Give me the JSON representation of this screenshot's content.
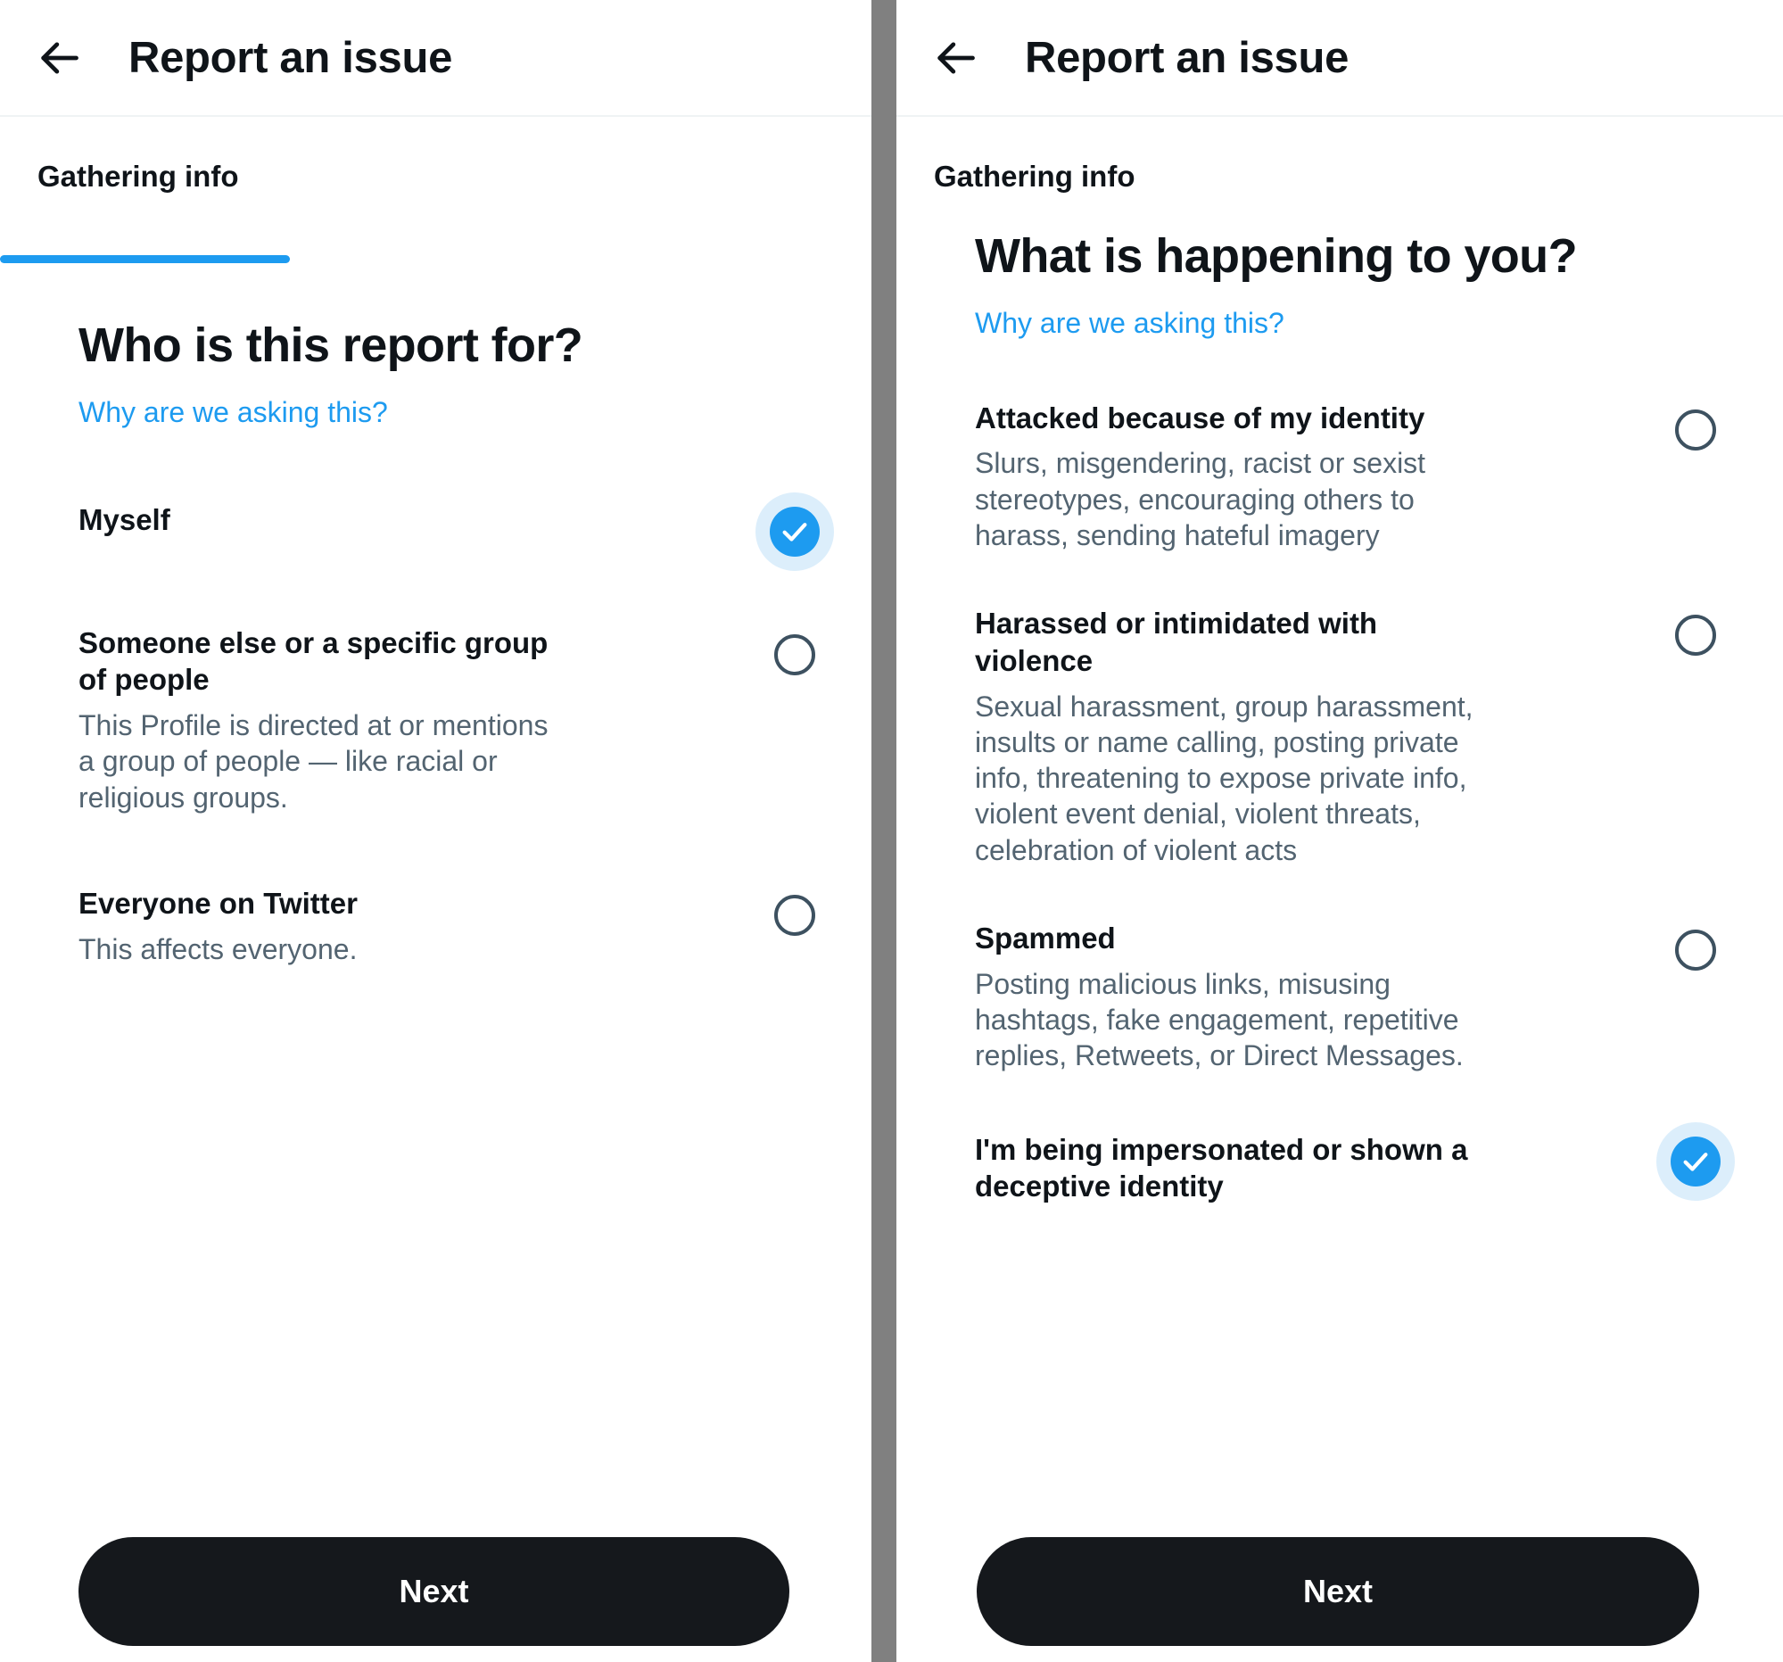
{
  "colors": {
    "accent": "#1d9bf0",
    "accent_halo": "#dceefb",
    "text_primary": "#0f1419",
    "text_secondary": "#536471",
    "button_bg": "#15181c",
    "divider": "#808080"
  },
  "left_panel": {
    "topbar": {
      "back_icon": "arrow-left-icon",
      "title": "Report an issue"
    },
    "step_tab": {
      "label": "Gathering info",
      "active": true
    },
    "question": "Who is this report for?",
    "why_link": "Why are we asking this?",
    "options": [
      {
        "title": "Myself",
        "desc": "",
        "selected": true
      },
      {
        "title": "Someone else or a specific group of people",
        "desc": "This Profile is directed at or mentions a group of people — like racial or religious groups.",
        "selected": false
      },
      {
        "title": "Everyone on Twitter",
        "desc": "This affects everyone.",
        "selected": false
      }
    ],
    "next_label": "Next"
  },
  "right_panel": {
    "topbar": {
      "back_icon": "arrow-left-icon",
      "title": "Report an issue"
    },
    "step_tab": {
      "label": "Gathering info",
      "active": false
    },
    "question": "What is happening to you?",
    "why_link": "Why are we asking this?",
    "options": [
      {
        "title": "Attacked because of my identity",
        "desc": "Slurs, misgendering, racist or sexist stereotypes, encouraging others to harass, sending hateful imagery",
        "selected": false
      },
      {
        "title": "Harassed or intimidated with violence",
        "desc": "Sexual harassment, group harassment, insults or name calling, posting private info, threatening to expose private info, violent event denial, violent threats, celebration of violent acts",
        "selected": false
      },
      {
        "title": "Spammed",
        "desc": "Posting malicious links, misusing hashtags, fake engagement, repetitive replies, Retweets, or Direct Messages.",
        "selected": false
      },
      {
        "title": "I'm being impersonated or shown a deceptive identity",
        "desc": "",
        "selected": true
      }
    ],
    "next_label": "Next"
  }
}
